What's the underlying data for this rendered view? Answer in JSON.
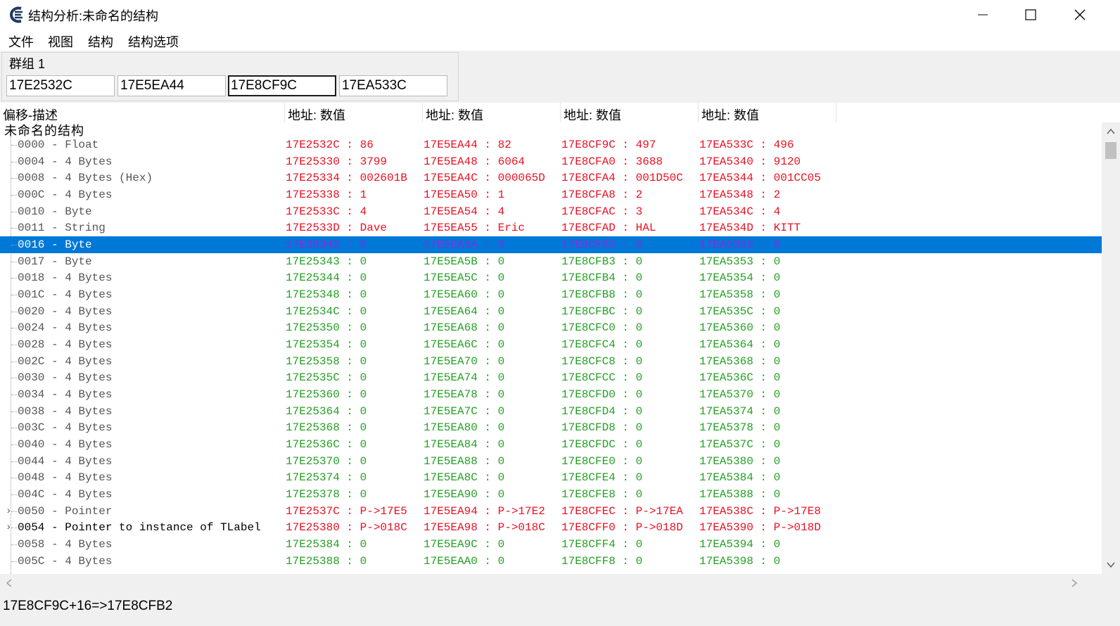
{
  "window": {
    "title": "结构分析:未命名的结构"
  },
  "menu": [
    "文件",
    "视图",
    "结构",
    "结构选项"
  ],
  "group": {
    "label": "群组 1",
    "addresses": [
      "17E2532C",
      "17E5EA44",
      "17E8CF9C",
      "17EA533C"
    ],
    "focused_index": 2
  },
  "headers": {
    "offset_desc": "偏移-描述",
    "columns": [
      "地址: 数值",
      "地址: 数值",
      "地址: 数值",
      "地址: 数值"
    ]
  },
  "root_label": "未命名的结构",
  "rows": [
    {
      "offset": "0000",
      "type": "Float",
      "color": "red",
      "cells": [
        "17E2532C : 86",
        "17E5EA44 : 82",
        "17E8CF9C : 497",
        "17EA533C : 496"
      ]
    },
    {
      "offset": "0004",
      "type": "4 Bytes",
      "color": "red",
      "cells": [
        "17E25330 : 3799",
        "17E5EA48 : 6064",
        "17E8CFA0 : 3688",
        "17EA5340 : 9120"
      ]
    },
    {
      "offset": "0008",
      "type": "4 Bytes (Hex)",
      "color": "red",
      "cells": [
        "17E25334 : 002601B",
        "17E5EA4C : 000065D",
        "17E8CFA4 : 001D50C",
        "17EA5344 : 001CC05"
      ]
    },
    {
      "offset": "000C",
      "type": "4 Bytes",
      "color": "red",
      "cells": [
        "17E25338 : 1",
        "17E5EA50 : 1",
        "17E8CFA8 : 2",
        "17EA5348 : 2"
      ]
    },
    {
      "offset": "0010",
      "type": "Byte",
      "color": "red",
      "cells": [
        "17E2533C : 4",
        "17E5EA54 : 4",
        "17E8CFAC : 3",
        "17EA534C : 4"
      ]
    },
    {
      "offset": "0011",
      "type": "String",
      "color": "red",
      "cells": [
        "17E2533D : Dave",
        "17E5EA55 : Eric",
        "17E8CFAD : HAL",
        "17EA534D : KITT"
      ]
    },
    {
      "offset": "0016",
      "type": "Byte",
      "color": "red",
      "selected": true,
      "cells": [
        "17E25342 : 0",
        "17E5EA5A : 0",
        "17E8CFB2 : 0",
        "17EA5352 : 0"
      ]
    },
    {
      "offset": "0017",
      "type": "Byte",
      "color": "green",
      "cells": [
        "17E25343 : 0",
        "17E5EA5B : 0",
        "17E8CFB3 : 0",
        "17EA5353 : 0"
      ]
    },
    {
      "offset": "0018",
      "type": "4 Bytes",
      "color": "green",
      "cells": [
        "17E25344 : 0",
        "17E5EA5C : 0",
        "17E8CFB4 : 0",
        "17EA5354 : 0"
      ]
    },
    {
      "offset": "001C",
      "type": "4 Bytes",
      "color": "green",
      "cells": [
        "17E25348 : 0",
        "17E5EA60 : 0",
        "17E8CFB8 : 0",
        "17EA5358 : 0"
      ]
    },
    {
      "offset": "0020",
      "type": "4 Bytes",
      "color": "green",
      "cells": [
        "17E2534C : 0",
        "17E5EA64 : 0",
        "17E8CFBC : 0",
        "17EA535C : 0"
      ]
    },
    {
      "offset": "0024",
      "type": "4 Bytes",
      "color": "green",
      "cells": [
        "17E25350 : 0",
        "17E5EA68 : 0",
        "17E8CFC0 : 0",
        "17EA5360 : 0"
      ]
    },
    {
      "offset": "0028",
      "type": "4 Bytes",
      "color": "green",
      "cells": [
        "17E25354 : 0",
        "17E5EA6C : 0",
        "17E8CFC4 : 0",
        "17EA5364 : 0"
      ]
    },
    {
      "offset": "002C",
      "type": "4 Bytes",
      "color": "green",
      "cells": [
        "17E25358 : 0",
        "17E5EA70 : 0",
        "17E8CFC8 : 0",
        "17EA5368 : 0"
      ]
    },
    {
      "offset": "0030",
      "type": "4 Bytes",
      "color": "green",
      "cells": [
        "17E2535C : 0",
        "17E5EA74 : 0",
        "17E8CFCC : 0",
        "17EA536C : 0"
      ]
    },
    {
      "offset": "0034",
      "type": "4 Bytes",
      "color": "green",
      "cells": [
        "17E25360 : 0",
        "17E5EA78 : 0",
        "17E8CFD0 : 0",
        "17EA5370 : 0"
      ]
    },
    {
      "offset": "0038",
      "type": "4 Bytes",
      "color": "green",
      "cells": [
        "17E25364 : 0",
        "17E5EA7C : 0",
        "17E8CFD4 : 0",
        "17EA5374 : 0"
      ]
    },
    {
      "offset": "003C",
      "type": "4 Bytes",
      "color": "green",
      "cells": [
        "17E25368 : 0",
        "17E5EA80 : 0",
        "17E8CFD8 : 0",
        "17EA5378 : 0"
      ]
    },
    {
      "offset": "0040",
      "type": "4 Bytes",
      "color": "green",
      "cells": [
        "17E2536C : 0",
        "17E5EA84 : 0",
        "17E8CFDC : 0",
        "17EA537C : 0"
      ]
    },
    {
      "offset": "0044",
      "type": "4 Bytes",
      "color": "green",
      "cells": [
        "17E25370 : 0",
        "17E5EA88 : 0",
        "17E8CFE0 : 0",
        "17EA5380 : 0"
      ]
    },
    {
      "offset": "0048",
      "type": "4 Bytes",
      "color": "green",
      "cells": [
        "17E25374 : 0",
        "17E5EA8C : 0",
        "17E8CFE4 : 0",
        "17EA5384 : 0"
      ]
    },
    {
      "offset": "004C",
      "type": "4 Bytes",
      "color": "green",
      "cells": [
        "17E25378 : 0",
        "17E5EA90 : 0",
        "17E8CFE8 : 0",
        "17EA5388 : 0"
      ]
    },
    {
      "offset": "0050",
      "type": "Pointer",
      "color": "red",
      "expandable": true,
      "cells": [
        "17E2537C : P->17E5",
        "17E5EA94 : P->17E2",
        "17E8CFEC : P->17EA",
        "17EA538C : P->17E8"
      ]
    },
    {
      "offset": "0054",
      "type": "Pointer to instance of TLabel",
      "color": "red",
      "expandable": true,
      "dark": true,
      "cells": [
        "17E25380 : P->018C",
        "17E5EA98 : P->018C",
        "17E8CFF0 : P->018D",
        "17EA5390 : P->018D"
      ]
    },
    {
      "offset": "0058",
      "type": "4 Bytes",
      "color": "green",
      "cells": [
        "17E25384 : 0",
        "17E5EA9C : 0",
        "17E8CFF4 : 0",
        "17EA5394 : 0"
      ]
    },
    {
      "offset": "005C",
      "type": "4 Bytes",
      "color": "green",
      "cells": [
        "17E25388 : 0",
        "17E5EAA0 : 0",
        "17E8CFF8 : 0",
        "17EA5398 : 0"
      ]
    }
  ],
  "status": "17E8CF9C+16=>17E8CFB2",
  "colors": {
    "selection": "#0078d7",
    "changed": "#e81123",
    "unchanged": "#25a025"
  }
}
